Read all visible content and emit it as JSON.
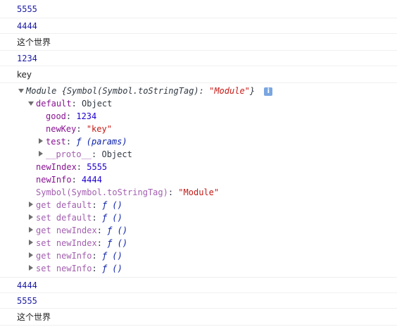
{
  "logs_top": [
    "5555",
    "4444",
    "这个世界",
    "1234",
    "key"
  ],
  "module": {
    "header_name": "Module",
    "header_detail": "{Symbol(Symbol.toStringTag): ",
    "header_tag_value": "\"Module\"",
    "header_close": "}",
    "info_icon_text": "i",
    "default_key": "default",
    "default_value": "Object",
    "good_key": "good",
    "good_value": "1234",
    "newkey_key": "newKey",
    "newkey_value": "\"key\"",
    "test_key": "test",
    "test_value": "ƒ (params)",
    "proto_key": "__proto__",
    "proto_value": "Object",
    "newindex_key": "newIndex",
    "newindex_value": "5555",
    "newinfo_key": "newInfo",
    "newinfo_value": "4444",
    "symbol_key": "Symbol(Symbol.toStringTag)",
    "symbol_value": "\"Module\"",
    "accessors": [
      {
        "label": "get default",
        "value": "ƒ ()"
      },
      {
        "label": "set default",
        "value": "ƒ ()"
      },
      {
        "label": "get newIndex",
        "value": "ƒ ()"
      },
      {
        "label": "set newIndex",
        "value": "ƒ ()"
      },
      {
        "label": "get newInfo",
        "value": "ƒ ()"
      },
      {
        "label": "set newInfo",
        "value": "ƒ ()"
      }
    ]
  },
  "logs_bottom": [
    "4444",
    "5555",
    "这个世界"
  ]
}
